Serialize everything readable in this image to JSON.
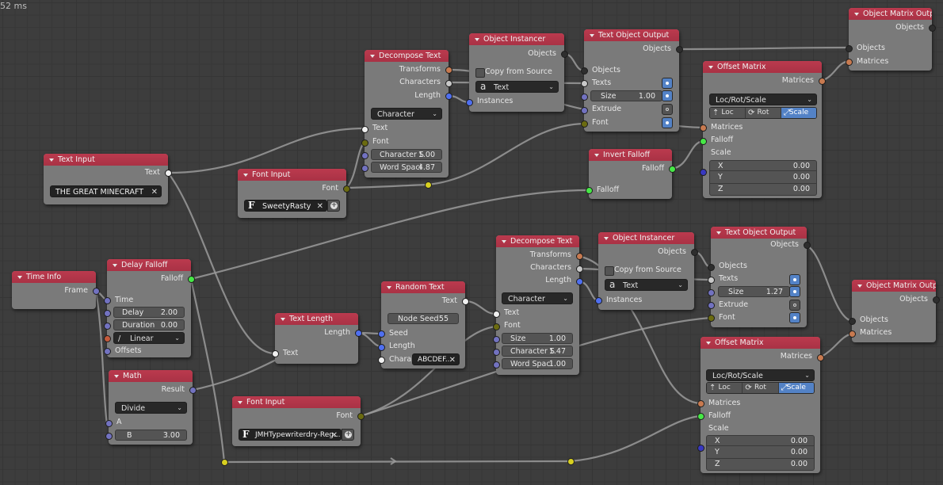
{
  "editor": {
    "stats": "52 ms"
  },
  "nodes": {
    "text_input": {
      "title": "Text Input",
      "outputs": {
        "text": "Text"
      },
      "value": "THE GREAT MINECRAFT"
    },
    "font_input_1": {
      "title": "Font Input",
      "outputs": {
        "font": "Font"
      },
      "font_name": "SweetyRasty"
    },
    "decompose_text_1": {
      "title": "Decompose Text",
      "outputs": {
        "transforms": "Transforms",
        "characters": "Characters",
        "length": "Length"
      },
      "mode": "Character",
      "inputs": {
        "text": "Text",
        "font": "Font"
      },
      "fields": [
        {
          "label": "Character S",
          "value": "1.00"
        },
        {
          "label": "Word Spaci",
          "value": "4.87"
        }
      ]
    },
    "object_instancer_1": {
      "title": "Object Instancer",
      "outputs": {
        "objects": "Objects"
      },
      "copy_from_source": "Copy from Source",
      "copy_from_source_checked": false,
      "type": "Text",
      "inputs": {
        "instances": "Instances"
      }
    },
    "text_object_output_1": {
      "title": "Text Object Output",
      "outputs": {
        "objects": "Objects"
      },
      "inputs": {
        "objects": "Objects",
        "texts": "Texts",
        "size_label": "Size",
        "size_value": "1.00",
        "extrude": "Extrude",
        "font": "Font"
      },
      "toggles": {
        "texts": true,
        "size": true,
        "extrude": false,
        "font": true
      }
    },
    "object_matrix_output_1": {
      "title": "Object Matrix Output",
      "outputs": {
        "objects": "Objects"
      },
      "inputs": {
        "objects": "Objects",
        "matrices": "Matrices"
      }
    },
    "offset_matrix_1": {
      "title": "Offset Matrix",
      "outputs": {
        "matrices": "Matrices"
      },
      "mode": "Loc/Rot/Scale",
      "segments": [
        {
          "label": "Loc",
          "icon": "arrow-up-icon",
          "active": false
        },
        {
          "label": "Rot",
          "icon": "rotate-icon",
          "active": false
        },
        {
          "label": "Scale",
          "icon": "scale-icon",
          "active": true
        }
      ],
      "inputs": {
        "matrices": "Matrices",
        "falloff": "Falloff",
        "scale": "Scale"
      },
      "vector": [
        {
          "label": "X",
          "value": "0.00"
        },
        {
          "label": "Y",
          "value": "0.00"
        },
        {
          "label": "Z",
          "value": "0.00"
        }
      ]
    },
    "invert_falloff": {
      "title": "Invert Falloff",
      "outputs": {
        "falloff": "Falloff"
      },
      "inputs": {
        "falloff": "Falloff"
      }
    },
    "time_info": {
      "title": "Time Info",
      "outputs": {
        "frame": "Frame"
      }
    },
    "delay_falloff": {
      "title": "Delay Falloff",
      "outputs": {
        "falloff": "Falloff"
      },
      "inputs": {
        "time": "Time",
        "offsets": "Offsets"
      },
      "fields": [
        {
          "label": "Delay",
          "value": "2.00"
        },
        {
          "label": "Duration",
          "value": "0.00"
        }
      ],
      "interpolation": "Linear"
    },
    "math": {
      "title": "Math",
      "outputs": {
        "result": "Result"
      },
      "operation": "Divide",
      "inputs": {
        "a": "A"
      },
      "fields": [
        {
          "label": "B",
          "value": "3.00"
        }
      ]
    },
    "text_length": {
      "title": "Text Length",
      "outputs": {
        "length": "Length"
      },
      "inputs": {
        "text": "Text"
      }
    },
    "random_text": {
      "title": "Random Text",
      "outputs": {
        "text": "Text"
      },
      "node_seed_label": "Node Seed",
      "node_seed_value": "55",
      "inputs": {
        "seed": "Seed",
        "length": "Length",
        "chara": "Chara"
      },
      "characters": "ABCDEF..."
    },
    "font_input_2": {
      "title": "Font Input",
      "outputs": {
        "font": "Font"
      },
      "font_name": "JMHTypewriterdry-Reg..."
    },
    "decompose_text_2": {
      "title": "Decompose Text",
      "outputs": {
        "transforms": "Transforms",
        "characters": "Characters",
        "length": "Length"
      },
      "mode": "Character",
      "inputs": {
        "text": "Text",
        "font": "Font"
      },
      "fields": [
        {
          "label": "Size",
          "value": "1.00"
        },
        {
          "label": "Character S",
          "value": "1.47"
        },
        {
          "label": "Word Spaci",
          "value": "1.00"
        }
      ]
    },
    "object_instancer_2": {
      "title": "Object Instancer",
      "outputs": {
        "objects": "Objects"
      },
      "copy_from_source": "Copy from Source",
      "copy_from_source_checked": false,
      "type": "Text",
      "inputs": {
        "instances": "Instances"
      }
    },
    "text_object_output_2": {
      "title": "Text Object Output",
      "outputs": {
        "objects": "Objects"
      },
      "inputs": {
        "objects": "Objects",
        "texts": "Texts",
        "size_label": "Size",
        "size_value": "1.27",
        "extrude": "Extrude",
        "font": "Font"
      },
      "toggles": {
        "texts": true,
        "size": true,
        "extrude": false,
        "font": true
      }
    },
    "object_matrix_output_2": {
      "title": "Object Matrix Output",
      "outputs": {
        "objects": "Objects"
      },
      "inputs": {
        "objects": "Objects",
        "matrices": "Matrices"
      }
    },
    "offset_matrix_2": {
      "title": "Offset Matrix",
      "outputs": {
        "matrices": "Matrices"
      },
      "mode": "Loc/Rot/Scale",
      "segments": [
        {
          "label": "Loc",
          "icon": "arrow-up-icon",
          "active": false
        },
        {
          "label": "Rot",
          "icon": "rotate-icon",
          "active": false
        },
        {
          "label": "Scale",
          "icon": "scale-icon",
          "active": true
        }
      ],
      "inputs": {
        "matrices": "Matrices",
        "falloff": "Falloff",
        "scale": "Scale"
      },
      "vector": [
        {
          "label": "X",
          "value": "0.00"
        },
        {
          "label": "Y",
          "value": "0.00"
        },
        {
          "label": "Z",
          "value": "0.00"
        }
      ]
    }
  },
  "socket_colors": {
    "text": "#f0f0f0",
    "font": "#6b6b10",
    "float": "#7272c0",
    "integer": "#4f6ff0",
    "matrix": "#c87a50",
    "object": "#2e2e2e",
    "falloff": "#46e846",
    "vector": "#3838c0",
    "reroute": "#d8d020"
  },
  "header_color": "#b23548"
}
